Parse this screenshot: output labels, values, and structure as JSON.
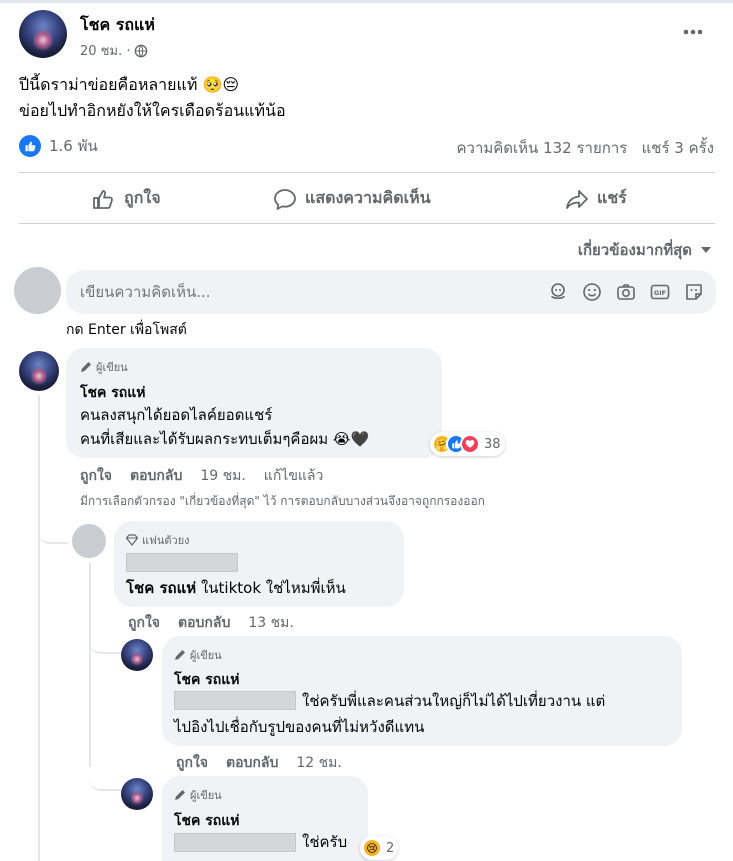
{
  "post": {
    "author": "โชค รถแห่",
    "time": "20 ชม. ·",
    "text_line1": "ปีนี้ดราม่าข่อยคือหลายแท้ 🥺😔",
    "text_line2": "ข่อยไปทำอิกหยังให้ใครเดือดร้อนแท้น้อ",
    "more_icon": "more-horizontal-icon",
    "privacy_icon": "globe-icon"
  },
  "stats": {
    "reactions": "1.6 พัน",
    "comments_shares": "ความคิดเห็น 132 รายการ   แชร์ 3 ครั้ง"
  },
  "toolbar": {
    "like": "ถูกใจ",
    "comment": "แสดงความคิดเห็น",
    "share": "แชร์"
  },
  "sort": {
    "label": "เกี่ยวข้องมากที่สุด"
  },
  "composer": {
    "placeholder": "เขียนความคิดเห็น...",
    "hint": "กด Enter เพื่อโพสต์",
    "icons": [
      "sticker-avatar-icon",
      "emoji-icon",
      "camera-icon",
      "gif-icon",
      "sticker-icon"
    ]
  },
  "comments": {
    "c1": {
      "badge": "ผู้เขียน",
      "author": "โชค รถแห่",
      "line1": "คนลงสนุกได้ยอดไลค์ยอดแชร์",
      "line2": "คนที่เสียและได้รับผลกระทบเต็มๆคือผม 😭🖤",
      "reaction_count": "38",
      "like": "ถูกใจ",
      "reply": "ตอบกลับ",
      "time": "19 ชม.",
      "edited": "แก้ไขแล้ว",
      "filter_note": "มีการเลือกตัวกรอง \"เกี่ยวข้องที่สุด\" ไว้ การตอบกลับบางส่วนจึงอาจถูกกรองออก"
    },
    "c2": {
      "badge": "แฟนตัวยง",
      "author": "โชค รถแห่",
      "text": " ในtiktok ใช่ไหมพี่เห็น",
      "like": "ถูกใจ",
      "reply": "ตอบกลับ",
      "time": "13 ชม."
    },
    "c3": {
      "badge": "ผู้เขียน",
      "author": "โชค รถแห่",
      "line1": "ใช่ครับพี่และคนส่วนใหญ่ก็ไม่ได้ไปเที่ยวงาน แต่",
      "line2": "ไปอิงไปเชื่อกับรูปของคนที่ไม่หวังดีแทน",
      "like": "ถูกใจ",
      "reply": "ตอบกลับ",
      "time": "12 ชม."
    },
    "c4": {
      "badge": "ผู้เขียน",
      "author": "โชค รถแห่",
      "text": "ใช่ครับ",
      "reaction_count": "2"
    }
  },
  "colors": {
    "like_blue": "#1877f2",
    "love_red": "#f33e58",
    "care_yellow": "#f7b125"
  }
}
